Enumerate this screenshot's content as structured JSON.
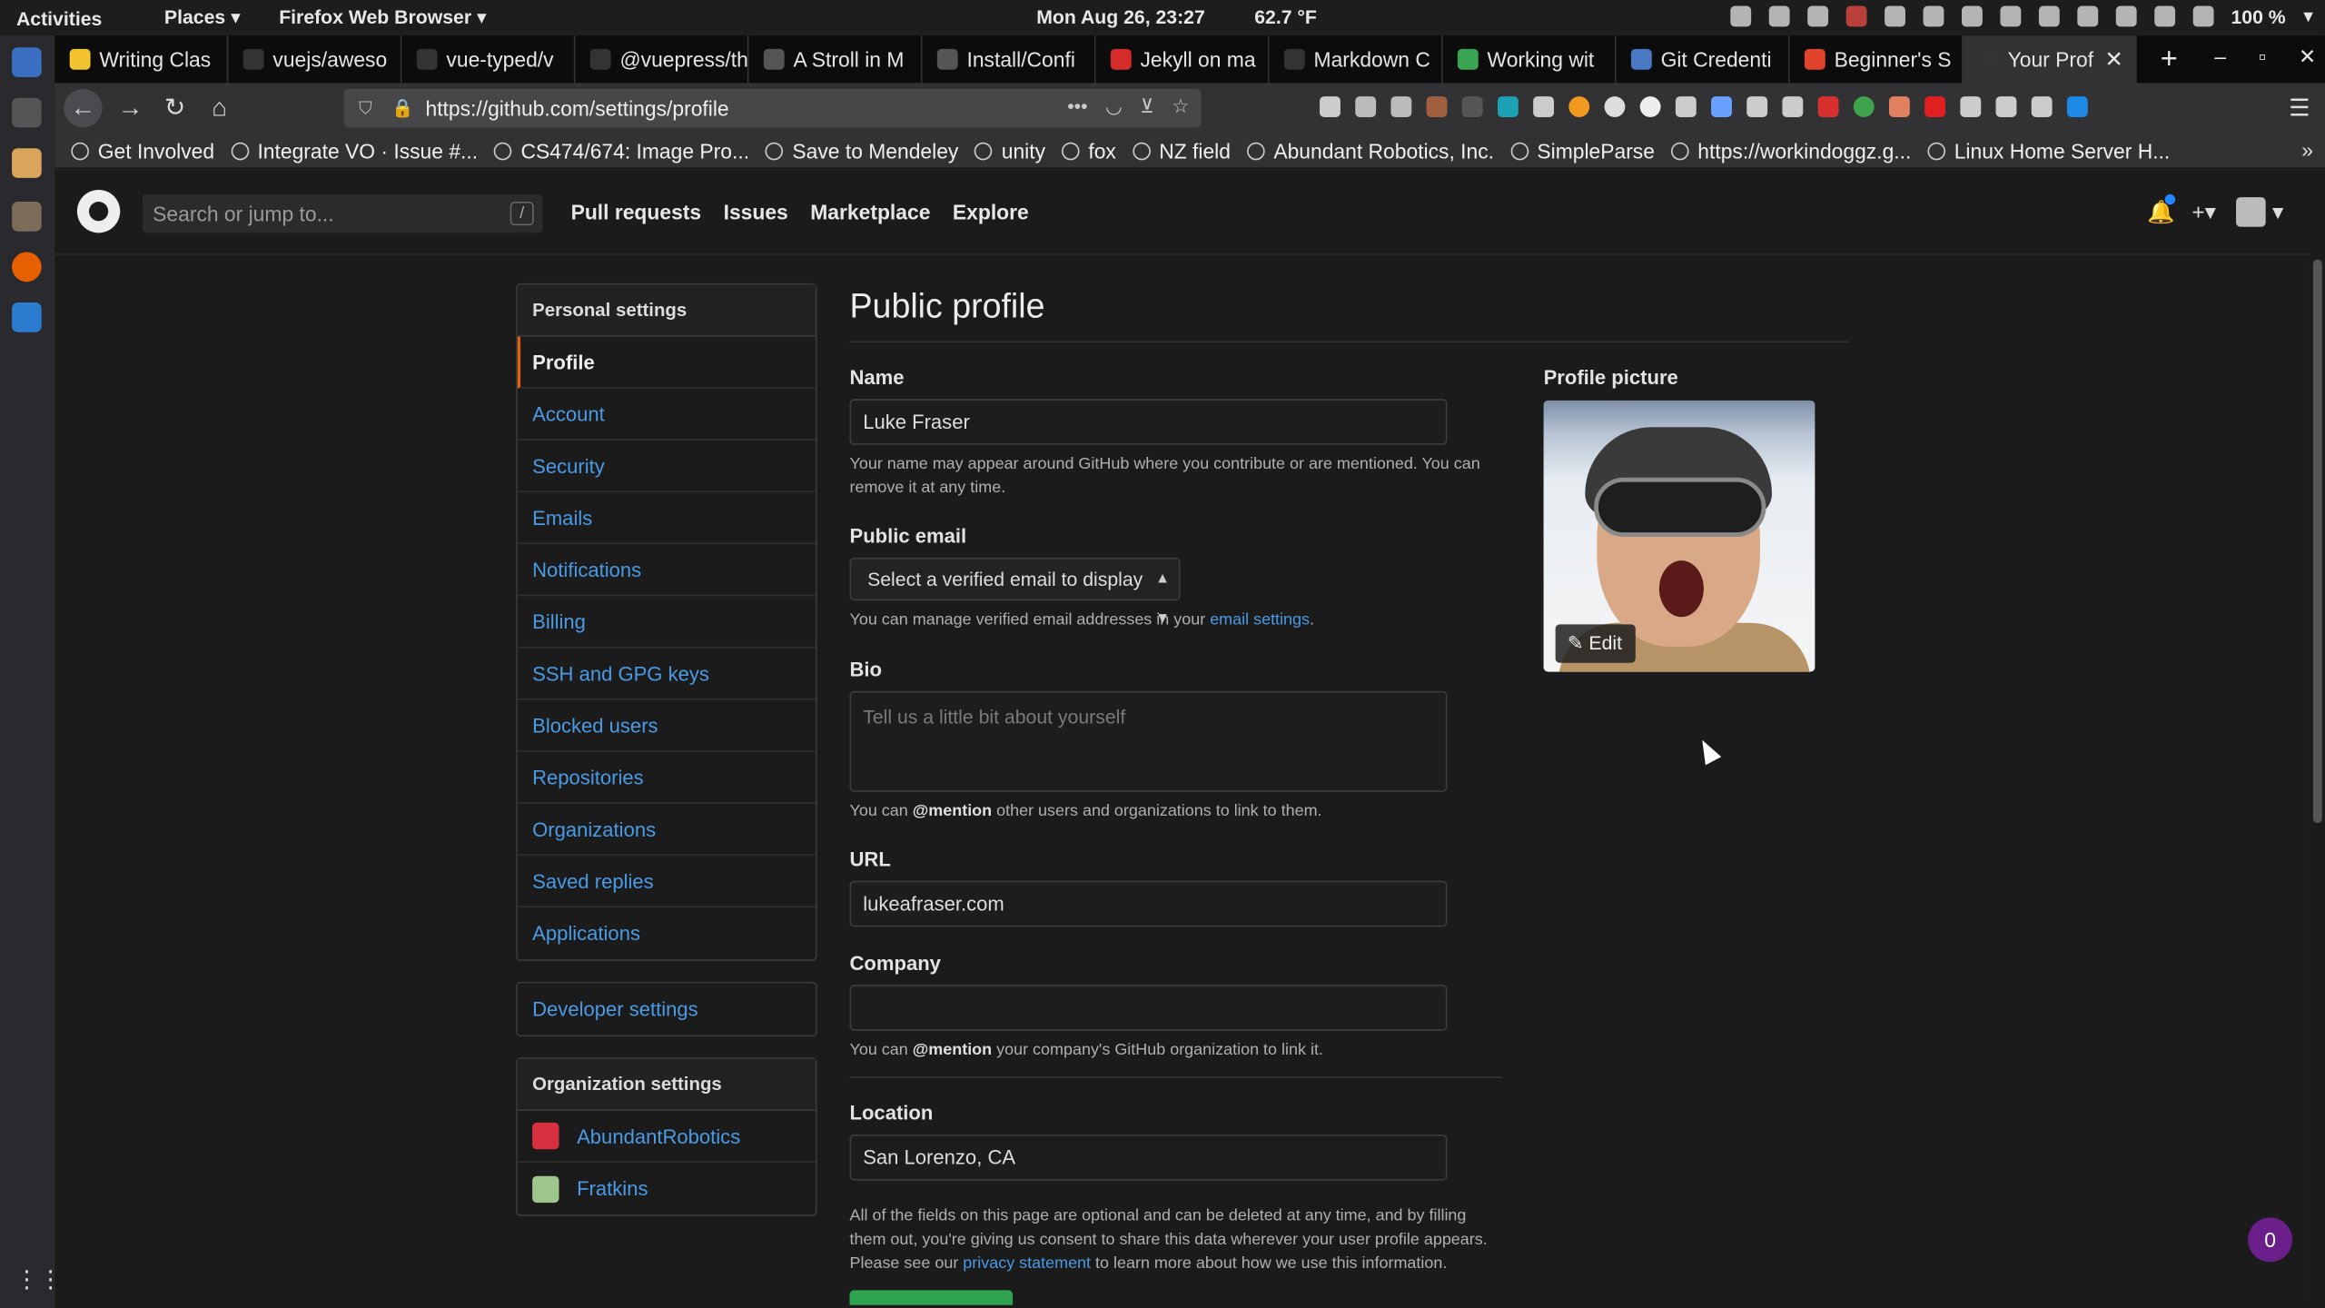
{
  "system_bar": {
    "activities": "Activities",
    "places": "Places ▾",
    "app_menu": "Firefox Web Browser ▾",
    "clock": "Mon Aug 26, 23:27",
    "weather": "62.7 °F",
    "battery": "100 %"
  },
  "tabs": [
    {
      "title": "Writing Clas",
      "color": "#f4c430"
    },
    {
      "title": "vuejs/aweso",
      "color": "#333333"
    },
    {
      "title": "vue-typed/v",
      "color": "#333333"
    },
    {
      "title": "@vuepress/the",
      "color": "#333333"
    },
    {
      "title": "A Stroll in M",
      "color": "#555555"
    },
    {
      "title": "Install/Confi",
      "color": "#555555"
    },
    {
      "title": "Jekyll on ma",
      "color": "#d62b2b"
    },
    {
      "title": "Markdown C",
      "color": "#333333"
    },
    {
      "title": "Working wit",
      "color": "#3aa655"
    },
    {
      "title": "Git Credenti",
      "color": "#4a78c2"
    },
    {
      "title": "Beginner's S",
      "color": "#e0442c"
    },
    {
      "title": "Your Prof",
      "color": "#333333",
      "active": true
    }
  ],
  "url": "https://github.com/settings/profile",
  "bookmarks": [
    "Get Involved",
    "Integrate VO · Issue #...",
    "CS474/674: Image Pro...",
    "Save to Mendeley",
    "unity",
    "fox",
    "NZ field",
    "Abundant Robotics, Inc.",
    "SimpleParse",
    "https://workindoggz.g...",
    "Linux Home Server H..."
  ],
  "header": {
    "search_placeholder": "Search or jump to...",
    "search_key": "/",
    "nav": [
      "Pull requests",
      "Issues",
      "Marketplace",
      "Explore"
    ]
  },
  "sidebar": {
    "personal_heading": "Personal settings",
    "items": [
      {
        "label": "Profile",
        "active": true
      },
      {
        "label": "Account"
      },
      {
        "label": "Security"
      },
      {
        "label": "Emails"
      },
      {
        "label": "Notifications"
      },
      {
        "label": "Billing"
      },
      {
        "label": "SSH and GPG keys"
      },
      {
        "label": "Blocked users"
      },
      {
        "label": "Repositories"
      },
      {
        "label": "Organizations"
      },
      {
        "label": "Saved replies"
      },
      {
        "label": "Applications"
      }
    ],
    "developer_settings": "Developer settings",
    "org_heading": "Organization settings",
    "orgs": [
      {
        "label": "AbundantRobotics",
        "color": "#d93040"
      },
      {
        "label": "Fratkins",
        "color": "#9ec58c"
      }
    ]
  },
  "profile": {
    "title": "Public profile",
    "name_label": "Name",
    "name_value": "Luke Fraser",
    "name_note": "Your name may appear around GitHub where you contribute or are mentioned. You can remove it at any time.",
    "email_label": "Public email",
    "email_select": "Select a verified email to display",
    "email_note_prefix": "You can manage verified email addresses in your ",
    "email_note_link": "email settings",
    "email_note_suffix": ".",
    "bio_label": "Bio",
    "bio_placeholder": "Tell us a little bit about yourself",
    "bio_note_prefix": "You can ",
    "bio_note_mention": "@mention",
    "bio_note_suffix": " other users and organizations to link to them.",
    "url_label": "URL",
    "url_value": "lukeafraser.com",
    "company_label": "Company",
    "company_value": "",
    "company_note_prefix": "You can ",
    "company_note_mention": "@mention",
    "company_note_suffix": " your company's GitHub organization to link it.",
    "location_label": "Location",
    "location_value": "San Lorenzo, CA",
    "footer_note_prefix": "All of the fields on this page are optional and can be deleted at any time, and by filling them out, you're giving us consent to share this data wherever your user profile appears. Please see our ",
    "footer_note_link": "privacy statement",
    "footer_note_suffix": " to learn more about how we use this information.",
    "picture_label": "Profile picture",
    "edit_label": "Edit"
  },
  "chat_badge": "0"
}
